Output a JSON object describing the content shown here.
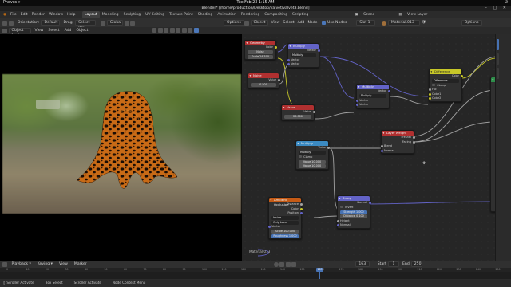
{
  "os": {
    "activities": "Pheves ▾",
    "clock": "Tue Feb 23  1:15 AM",
    "tray": "⏻"
  },
  "window": {
    "title": "Blender* [/home/production/Desktop/valvet/valvet3.blend]"
  },
  "menu": {
    "items": [
      "File",
      "Edit",
      "Render",
      "Window",
      "Help"
    ],
    "workspaces": [
      "Layout",
      "Modeling",
      "Sculpting",
      "UV Editing",
      "Texture Paint",
      "Shading",
      "Animation",
      "Rendering",
      "Compositing",
      "Scripting"
    ],
    "active_workspace": "Layout",
    "scene_label": "Scene",
    "view_layer_label": "View Layer"
  },
  "viewport_header": {
    "orientation_label": "Orientation:",
    "orientation_value": "Default",
    "drag_label": "Drag:",
    "drag_value": "Select Box",
    "global_value": "Global",
    "options_label": "Options",
    "mode_value": "Object Mode",
    "menu_items": [
      "View",
      "Select",
      "Add",
      "Object"
    ]
  },
  "node_header": {
    "object_value": "Object",
    "menu_items": [
      "View",
      "Select",
      "Add",
      "Node"
    ],
    "use_nodes_label": "Use Nodes",
    "slot_value": "Slot 1",
    "material_value": "Material.013",
    "options_label": "Options"
  },
  "material_breadcrumb": "Material.013",
  "nodes": {
    "geometry": {
      "title": "Geometry",
      "rows": [
        "Color",
        "Noise",
        "Scale  24.500"
      ]
    },
    "multiply1": {
      "title": "Multiply",
      "rows": [
        "Vector",
        "Multiply",
        "Vector",
        "Vector"
      ]
    },
    "noise": {
      "title": "Noise",
      "rows": [
        "Value",
        "0.500"
      ]
    },
    "multiply2": {
      "title": "Multiply",
      "rows": [
        "Vector",
        "Multiply",
        "Vector",
        "Vector"
      ]
    },
    "value": {
      "title": "Value",
      "rows": [
        "Value",
        "20.000"
      ]
    },
    "difference": {
      "title": "Difference",
      "rows": [
        "Color",
        "Difference",
        "Clamp",
        "Fac",
        "Color1",
        "Color2"
      ]
    },
    "layer_weight": {
      "title": "Layer Weight",
      "rows": [
        "Fresnel",
        "Facing",
        "Blend",
        "Normal"
      ]
    },
    "multiply3": {
      "title": "Multiply",
      "rows": [
        "Value",
        "Multiply",
        "Clamp",
        "Value  10.000",
        "Value  10.000"
      ]
    },
    "ambient_occlusion": {
      "title": "Ambient Occlusion",
      "rows": [
        "Distance",
        "Color",
        "Position",
        "Inside",
        "Only Local",
        "Vector",
        "Scale  100.000",
        "Roughness  1.000"
      ]
    },
    "bump": {
      "title": "Bump",
      "rows": [
        "Normal",
        "Invert",
        "Strength  1.000",
        "Distance  0.100",
        "Height",
        "Normal"
      ]
    }
  },
  "timeline": {
    "menu_items": [
      "Playback ▾",
      "Keying ▾",
      "View",
      "Marker"
    ],
    "current_frame": "163",
    "start_label": "Start",
    "start_value": "1",
    "end_label": "End",
    "end_value": "250",
    "ruler": [
      "0",
      "10",
      "20",
      "30",
      "40",
      "50",
      "60",
      "70",
      "80",
      "90",
      "100",
      "110",
      "120",
      "130",
      "140",
      "150",
      "160",
      "170",
      "180",
      "190",
      "200",
      "210",
      "220",
      "230",
      "240",
      "250"
    ]
  },
  "status": {
    "items": [
      "Scroller Activate",
      "Box Select",
      "Scroller Activate",
      "Node Context Menu"
    ]
  },
  "colors": {
    "accent": "#4772b3",
    "header_vector": "#6363c7",
    "header_color": "#c7c729",
    "header_input": "#b13030",
    "header_converter": "#3b8ac2",
    "header_shader": "#2e8e4a"
  }
}
